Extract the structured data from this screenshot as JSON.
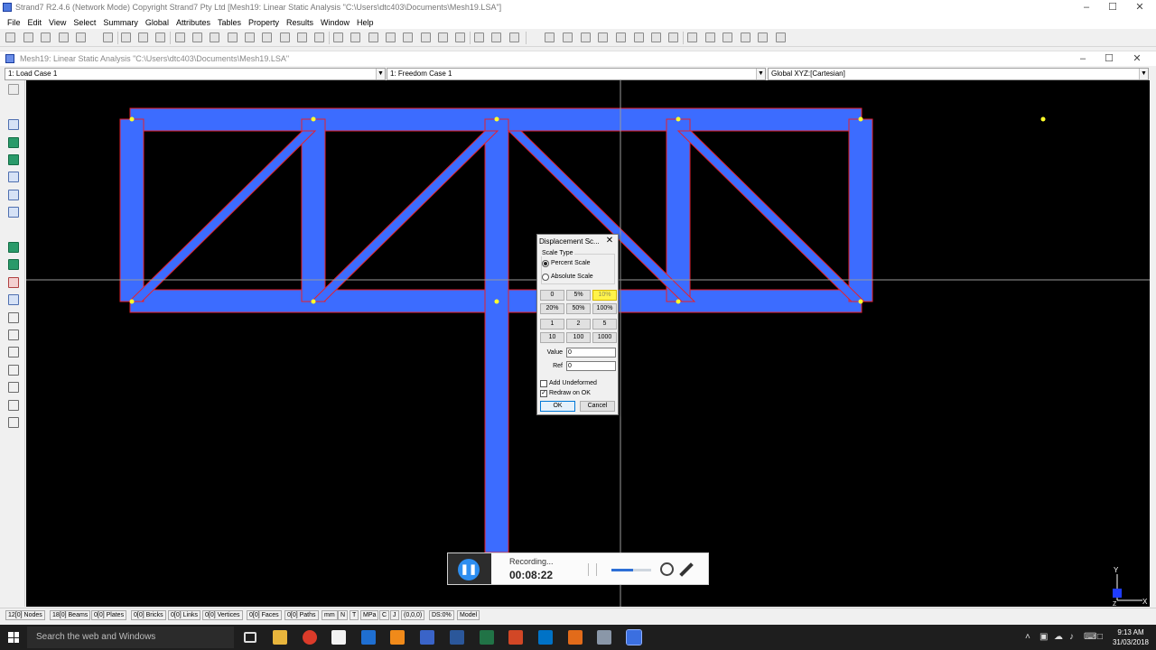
{
  "window": {
    "title": "Strand7 R2.4.6 (Network Mode) Copyright Strand7 Pty Ltd [Mesh19: Linear Static Analysis \"C:\\Users\\dtc403\\Documents\\Mesh19.LSA\"]"
  },
  "menu": [
    "File",
    "Edit",
    "View",
    "Select",
    "Summary",
    "Global",
    "Attributes",
    "Tables",
    "Property",
    "Results",
    "Window",
    "Help"
  ],
  "child_window": {
    "title": "Mesh19: Linear Static Analysis \"C:\\Users\\dtc403\\Documents\\Mesh19.LSA\""
  },
  "combos": {
    "load_case": "1: Load Case 1",
    "freedom_case": "1: Freedom Case 1",
    "coord_system": "Global XYZ:[Cartesian]"
  },
  "dialog": {
    "title": "Displacement Sc...",
    "close_glyph": "✕",
    "group_label": "Scale Type",
    "radio_percent": "Percent Scale",
    "radio_absolute": "Absolute Scale",
    "percent_buttons": [
      "0",
      "5%",
      "10%",
      "20%",
      "50%",
      "100%"
    ],
    "absolute_buttons": [
      "1",
      "2",
      "5",
      "10",
      "100",
      "1000"
    ],
    "value_label": "Value",
    "value": "0",
    "ref_label": "Ref",
    "ref": "0",
    "add_undeformed": "Add Undeformed",
    "redraw_on_ok": "Redraw on OK",
    "ok": "OK",
    "cancel": "Cancel"
  },
  "recorder": {
    "status": "Recording...",
    "time": "00:08:22"
  },
  "axis": {
    "y": "Y",
    "x": "X",
    "z": "Z"
  },
  "statusbar": [
    "12[0] Nodes",
    "18[0] Beams",
    "0[0] Plates",
    "0[0] Bricks",
    "0[0] Links",
    "0[0] Vertices",
    "0[0] Faces",
    "0[0] Paths",
    "mm",
    "N",
    "T",
    "MPa",
    "C",
    "J",
    "(0,0,0)",
    "DS:0%",
    "Model"
  ],
  "taskbar": {
    "search_placeholder": "Search the web and Windows",
    "time": "9:13 AM",
    "date": "31/03/2018"
  },
  "colors": {
    "beam_fill": "#3c6cff",
    "beam_outline": "#e8202a",
    "node": "#ffff2a",
    "canvas_bg": "#000000",
    "highlight_button": "#fff34a"
  }
}
